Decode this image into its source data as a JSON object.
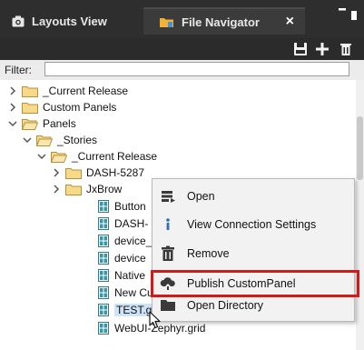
{
  "tabs": {
    "layouts": {
      "label": "Layouts View",
      "icon": "camera-icon"
    },
    "file_navigator": {
      "label": "File Navigator",
      "icon": "folder-icon",
      "close_glyph": "×"
    }
  },
  "toolbar": {
    "buttons": [
      "save-icon",
      "plus-icon",
      "delete-icon"
    ]
  },
  "filter": {
    "label": "Filter:",
    "value": ""
  },
  "tree": {
    "current_release": "_Current Release",
    "custom_panels": "Custom Panels",
    "panels": "Panels",
    "stories": "_Stories",
    "current_release_child": "_Current Release",
    "dash_5287": "DASH-5287",
    "jxbrow": "JxBrow",
    "button": "Button",
    "dash_2": "DASH-",
    "device_1": "device_",
    "device_2": "device",
    "native": "Native",
    "new_cu": "New Cu",
    "test_grid": "TEST.grid",
    "webui": "WebUI-Zephyr.grid"
  },
  "context_menu": {
    "items": [
      {
        "label": "Open",
        "icon": "open-icon"
      },
      {
        "label": "View Connection Settings",
        "icon": "info-icon"
      },
      {
        "label": "Remove",
        "icon": "trash-icon"
      },
      {
        "label": "Publish CustomPanel",
        "icon": "cloud-upload-icon"
      },
      {
        "label": "Open Directory",
        "icon": "folder-open-icon"
      }
    ]
  },
  "colors": {
    "highlight": "#d31a1a",
    "folder": "#f2c75a",
    "tab_bg": "#2e2e2e"
  }
}
